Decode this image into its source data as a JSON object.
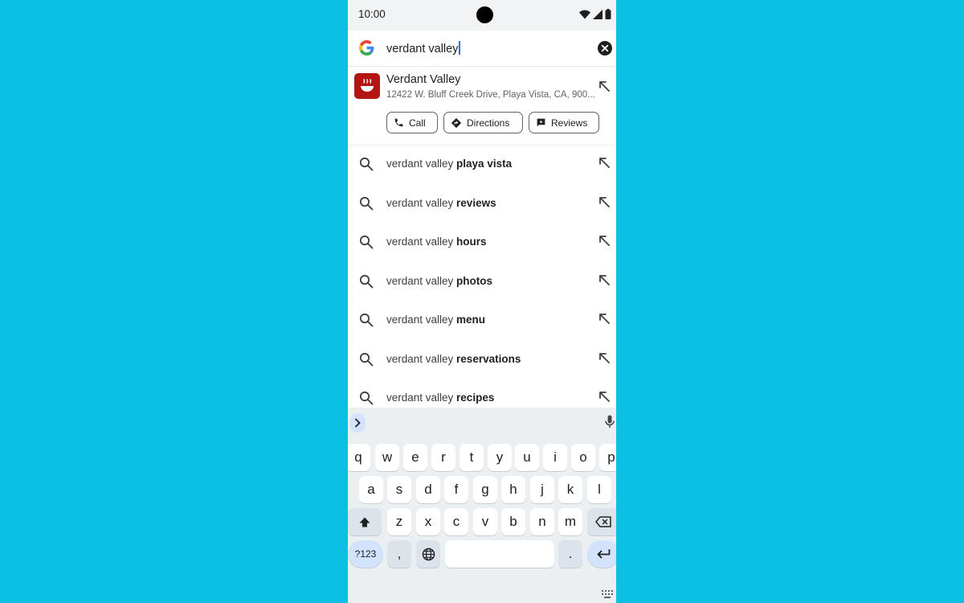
{
  "status_bar": {
    "time": "10:00"
  },
  "search": {
    "query": "verdant valley"
  },
  "entity": {
    "name": "Verdant Valley",
    "address": "12422 W. Bluff Creek Drive, Playa Vista, CA, 900...",
    "brand_color": "#b31414",
    "actions": [
      {
        "label": "Call",
        "icon": "phone-icon"
      },
      {
        "label": "Directions",
        "icon": "directions-icon"
      },
      {
        "label": "Reviews",
        "icon": "reviews-icon"
      }
    ]
  },
  "suggestions": [
    {
      "prefix": "verdant valley ",
      "bold": "playa vista"
    },
    {
      "prefix": "verdant valley ",
      "bold": "reviews"
    },
    {
      "prefix": "verdant valley ",
      "bold": "hours"
    },
    {
      "prefix": "verdant valley ",
      "bold": "photos"
    },
    {
      "prefix": "verdant valley ",
      "bold": "menu"
    },
    {
      "prefix": "verdant valley ",
      "bold": "reservations"
    },
    {
      "prefix": "verdant valley ",
      "bold": "recipes"
    }
  ],
  "keyboard": {
    "row1": [
      "q",
      "w",
      "e",
      "r",
      "t",
      "y",
      "u",
      "i",
      "o",
      "p"
    ],
    "row2": [
      "a",
      "s",
      "d",
      "f",
      "g",
      "h",
      "j",
      "k",
      "l"
    ],
    "row3": [
      "z",
      "x",
      "c",
      "v",
      "b",
      "n",
      "m"
    ],
    "symbols_label": "?123",
    "comma": ",",
    "period": "."
  },
  "colors": {
    "background": "#0cc0e3",
    "accent": "#1a73e8",
    "key_highlight": "#d3e3fd"
  }
}
